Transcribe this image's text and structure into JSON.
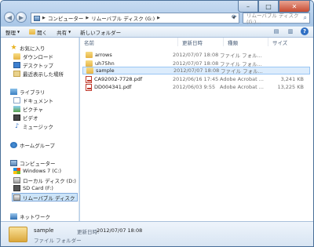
{
  "window": {
    "controls": {
      "minimize": "–",
      "maximize": "□",
      "close": "✕"
    }
  },
  "address": {
    "segments": [
      "コンピューター",
      "リムーバブル ディスク (G:)"
    ],
    "search_placeholder": "リムーバブル ディスク (G:)..."
  },
  "toolbar": {
    "organize": "整理",
    "open": "開く",
    "share": "共有",
    "new_folder": "新しいフォルダー"
  },
  "nav": {
    "favorites": "お気に入り",
    "downloads": "ダウンロード",
    "desktop": "デスクトップ",
    "recent": "最近表示した場所",
    "libraries": "ライブラリ",
    "documents": "ドキュメント",
    "pictures": "ピクチャ",
    "videos": "ビデオ",
    "music": "ミュージック",
    "homegroup": "ホームグループ",
    "computer": "コンピューター",
    "drive_c": "Windows 7 (C:)",
    "drive_d": "ローカル ディスク (D:)",
    "drive_f": "SD Card (F:)",
    "drive_g": "リムーバブル ディスク",
    "network": "ネットワーク"
  },
  "columns": {
    "name": "名前",
    "date": "更新日時",
    "type": "種類",
    "size": "サイズ"
  },
  "files": [
    {
      "name": "arrows",
      "date": "2012/07/07 18:08",
      "type": "ファイル フォル...",
      "size": "",
      "kind": "folder"
    },
    {
      "name": "uh75hn",
      "date": "2012/07/07 18:08",
      "type": "ファイル フォル...",
      "size": "",
      "kind": "folder"
    },
    {
      "name": "sample",
      "date": "2012/07/07 18:08",
      "type": "ファイル フォル...",
      "size": "",
      "kind": "folder"
    },
    {
      "name": "CA92002-7728.pdf",
      "date": "2012/06/16 17:45",
      "type": "Adobe Acrobat ...",
      "size": "3,241 KB",
      "kind": "pdf"
    },
    {
      "name": "DD004341.pdf",
      "date": "2012/06/03 9:55",
      "type": "Adobe Acrobat ...",
      "size": "13,225 KB",
      "kind": "pdf"
    }
  ],
  "details": {
    "name": "sample",
    "modified_label": "更新日時:",
    "modified": "2012/07/07 18:08",
    "type": "ファイル フォルダー"
  }
}
